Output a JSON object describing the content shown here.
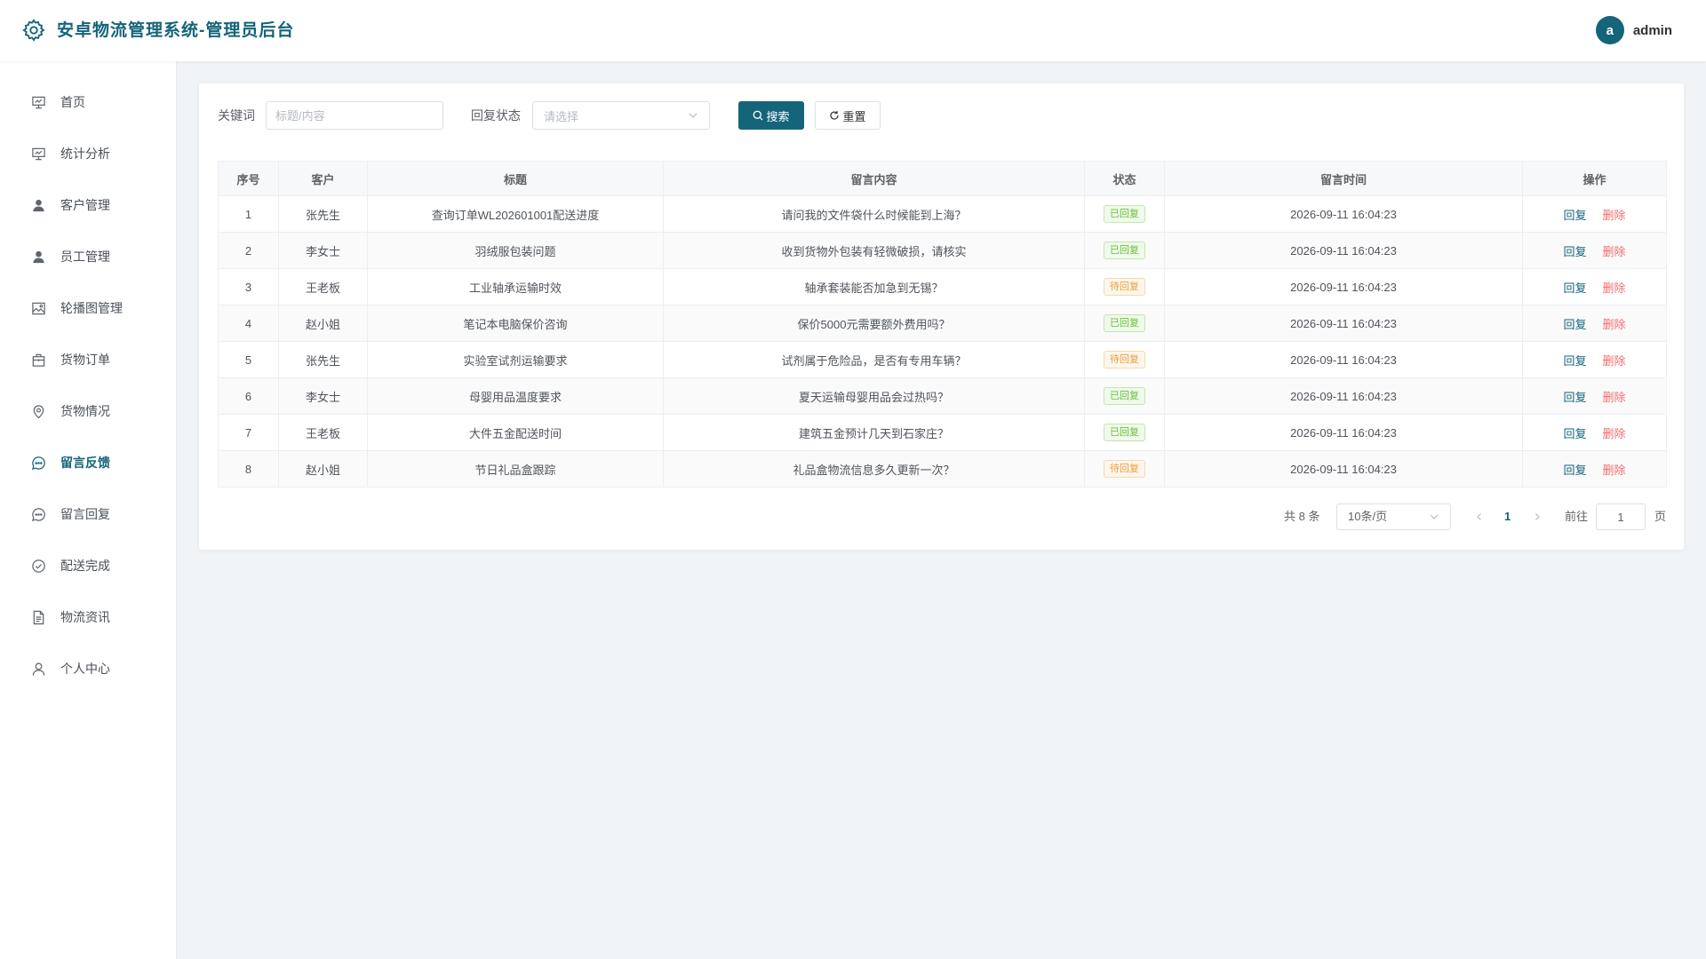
{
  "header": {
    "title": "安卓物流管理系统-管理员后台",
    "avatar_letter": "a",
    "username": "admin"
  },
  "sidebar": {
    "items": [
      {
        "label": "首页",
        "icon": "presentation-icon"
      },
      {
        "label": "统计分析",
        "icon": "presentation-icon"
      },
      {
        "label": "客户管理",
        "icon": "user-solid-icon"
      },
      {
        "label": "员工管理",
        "icon": "user-solid-icon"
      },
      {
        "label": "轮播图管理",
        "icon": "picture-icon"
      },
      {
        "label": "货物订单",
        "icon": "briefcase-icon"
      },
      {
        "label": "货物情况",
        "icon": "location-icon"
      },
      {
        "label": "留言反馈",
        "icon": "chat-icon"
      },
      {
        "label": "留言回复",
        "icon": "chat-icon"
      },
      {
        "label": "配送完成",
        "icon": "check-circle-icon"
      },
      {
        "label": "物流资讯",
        "icon": "document-icon"
      },
      {
        "label": "个人中心",
        "icon": "user-icon"
      }
    ],
    "active_index": 7
  },
  "filter": {
    "keyword_label": "关键词",
    "keyword_placeholder": "标题/内容",
    "status_label": "回复状态",
    "status_placeholder": "请选择",
    "search_label": "搜索",
    "reset_label": "重置"
  },
  "table": {
    "columns": [
      "序号",
      "客户",
      "标题",
      "留言内容",
      "状态",
      "留言时间",
      "操作"
    ],
    "rows": [
      {
        "no": "1",
        "customer": "张先生",
        "title": "查询订单WL202601001配送进度",
        "content": "请问我的文件袋什么时候能到上海？",
        "status": "已回复",
        "time": "2026-09-11 16:04:23"
      },
      {
        "no": "2",
        "customer": "李女士",
        "title": "羽绒服包装问题",
        "content": "收到货物外包装有轻微破损，请核实",
        "status": "已回复",
        "time": "2026-09-11 16:04:23"
      },
      {
        "no": "3",
        "customer": "王老板",
        "title": "工业轴承运输时效",
        "content": "轴承套装能否加急到无锡？",
        "status": "待回复",
        "time": "2026-09-11 16:04:23"
      },
      {
        "no": "4",
        "customer": "赵小姐",
        "title": "笔记本电脑保价咨询",
        "content": "保价5000元需要额外费用吗？",
        "status": "已回复",
        "time": "2026-09-11 16:04:23"
      },
      {
        "no": "5",
        "customer": "张先生",
        "title": "实验室试剂运输要求",
        "content": "试剂属于危险品，是否有专用车辆？",
        "status": "待回复",
        "time": "2026-09-11 16:04:23"
      },
      {
        "no": "6",
        "customer": "李女士",
        "title": "母婴用品温度要求",
        "content": "夏天运输母婴用品会过热吗？",
        "status": "已回复",
        "time": "2026-09-11 16:04:23"
      },
      {
        "no": "7",
        "customer": "王老板",
        "title": "大件五金配送时间",
        "content": "建筑五金预计几天到石家庄？",
        "status": "已回复",
        "time": "2026-09-11 16:04:23"
      },
      {
        "no": "8",
        "customer": "赵小姐",
        "title": "节日礼品盒跟踪",
        "content": "礼品盒物流信息多久更新一次？",
        "status": "待回复",
        "time": "2026-09-11 16:04:23"
      }
    ],
    "reply_label": "回复",
    "delete_label": "删除"
  },
  "pagination": {
    "total_text": "共 8 条",
    "page_size": "10条/页",
    "current_page": "1",
    "goto_label": "前往",
    "goto_value": "1",
    "page_suffix": "页"
  },
  "colors": {
    "primary": "#14647a",
    "replied": "#67c23a",
    "pending": "#e6a23c",
    "danger": "#f56c6c"
  }
}
